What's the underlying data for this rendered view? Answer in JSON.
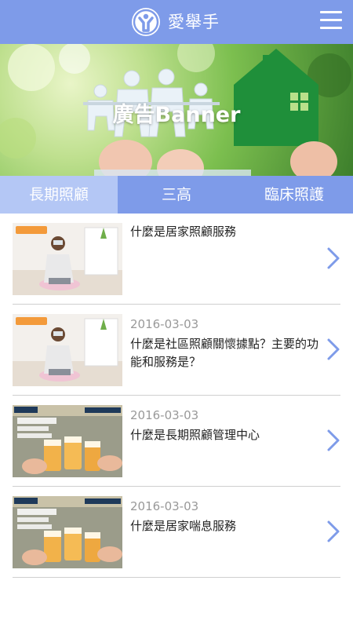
{
  "header": {
    "app_title": "愛舉手",
    "logo_icon": "raised-hand-person-icon",
    "menu_icon": "hamburger-menu-icon"
  },
  "banner": {
    "label": "廣告Banner"
  },
  "tabs": [
    {
      "label": "長期照顧",
      "active": true
    },
    {
      "label": "三高",
      "active": false
    },
    {
      "label": "臨床照護",
      "active": false
    }
  ],
  "articles": [
    {
      "date": "",
      "title": "什麼是居家照顧服務",
      "thumb": "woman-sitting-photo"
    },
    {
      "date": "2016-03-03",
      "title": "什麼是社區照顧關懷據點？主要的功能和服務是？",
      "thumb": "woman-sitting-photo"
    },
    {
      "date": "2016-03-03",
      "title": "什麼是長期照顧管理中心",
      "thumb": "beer-toast-photo"
    },
    {
      "date": "2016-03-03",
      "title": "什麼是居家喘息服務",
      "thumb": "beer-toast-photo"
    }
  ],
  "colors": {
    "primary": "#7e9be9",
    "tab_active": "#b4c7f5",
    "chevron": "#7e9be9"
  }
}
